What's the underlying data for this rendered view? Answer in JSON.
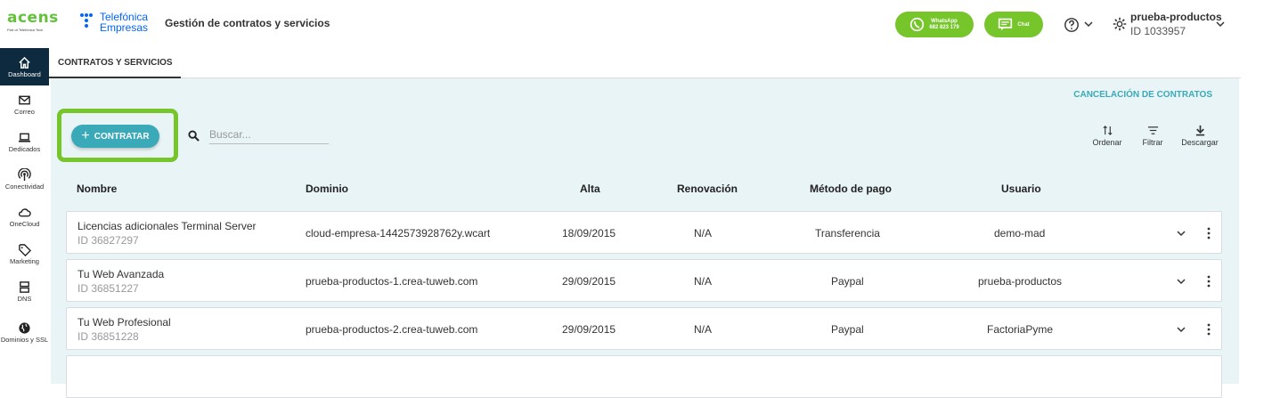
{
  "header": {
    "brand": "acens",
    "brand_sub": "Part of Telefónica Tech",
    "partner_line1": "Telefónica",
    "partner_line2": "Empresas",
    "title": "Gestión de contratos y servicios",
    "whatsapp_label": "WhatsApp",
    "whatsapp_number": "682 823 179",
    "chat_label": "Chat",
    "user_name": "prueba-productos",
    "user_id": "ID 1033957"
  },
  "sidebar": {
    "items": [
      {
        "label": "Dashboard",
        "icon": "home-icon"
      },
      {
        "label": "Correo",
        "icon": "mail-icon"
      },
      {
        "label": "Dedicados",
        "icon": "laptop-icon"
      },
      {
        "label": "Conectividad",
        "icon": "signal-icon"
      },
      {
        "label": "OneCloud",
        "icon": "cloud-icon"
      },
      {
        "label": "Marketing",
        "icon": "tag-icon"
      },
      {
        "label": "DNS",
        "icon": "server-icon"
      },
      {
        "label": "Dominios y SSL",
        "icon": "globe-icon"
      }
    ]
  },
  "tabs": [
    "CONTRATOS Y SERVICIOS"
  ],
  "main": {
    "cancel_link": "CANCELACIÓN DE CONTRATOS",
    "contratar_label": "CONTRATAR",
    "search_placeholder": "Buscar...",
    "tools": {
      "sort": "Ordenar",
      "filter": "Filtrar",
      "download": "Descargar"
    }
  },
  "table": {
    "columns": [
      "Nombre",
      "Dominio",
      "Alta",
      "Renovación",
      "Método de pago",
      "Usuario"
    ],
    "rows": [
      {
        "name": "Licencias adicionales Terminal Server",
        "id": "ID 36827297",
        "domain": "cloud-empresa-1442573928762y.wcart",
        "alta": "18/09/2015",
        "renovacion": "N/A",
        "pago": "Transferencia",
        "usuario": "demo-mad"
      },
      {
        "name": "Tu Web Avanzada",
        "id": "ID 36851227",
        "domain": "prueba-productos-1.crea-tuweb.com",
        "alta": "29/09/2015",
        "renovacion": "N/A",
        "pago": "Paypal",
        "usuario": "prueba-productos"
      },
      {
        "name": "Tu Web Profesional",
        "id": "ID 36851228",
        "domain": "prueba-productos-2.crea-tuweb.com",
        "alta": "29/09/2015",
        "renovacion": "N/A",
        "pago": "Paypal",
        "usuario": "FactoriaPyme"
      }
    ]
  },
  "colors": {
    "accent_green": "#76c52b",
    "teal": "#3aa9b8",
    "navy": "#0d2a3e",
    "panel_bg": "#e8f4f6"
  }
}
